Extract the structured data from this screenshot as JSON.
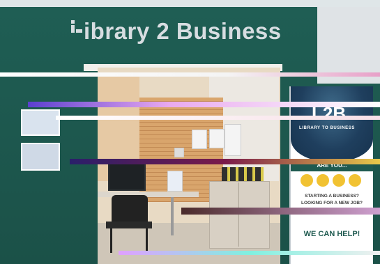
{
  "sign": {
    "mark": "L",
    "text": "ibrary 2 Business"
  },
  "banner": {
    "logo": "L2B",
    "subtitle": "LIBRARY TO BUSINESS",
    "are_you": "ARE YOU...",
    "starting": "STARTING A BUSINESS?",
    "looking": "LOOKING FOR A NEW JOB?",
    "help": "WE CAN HELP!"
  },
  "colors": {
    "wall": "#1f5a50",
    "sign_text": "#d7dde1",
    "banner_navy": "#1f3f5e",
    "banner_accent": "#f1c232"
  }
}
